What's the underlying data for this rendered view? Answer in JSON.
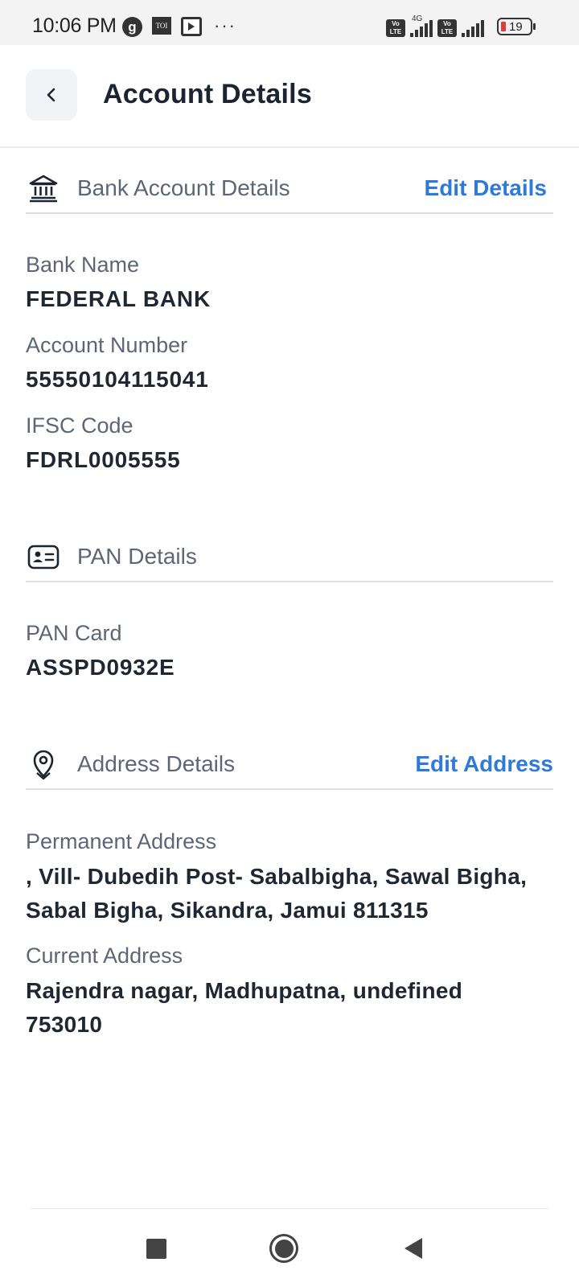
{
  "status_bar": {
    "time": "10:06 PM",
    "icons": [
      "g-app-icon",
      "toi-icon",
      "media-play-icon",
      "more-dots-icon",
      "volte-icon",
      "4g-signal-icon",
      "volte-icon",
      "signal-icon",
      "battery-icon"
    ],
    "g_label": "g",
    "toi_label": "TOI",
    "more": "···",
    "volte_label": "Vo LTE",
    "network_label": "4G",
    "battery": "19"
  },
  "header": {
    "title": "Account Details"
  },
  "bank": {
    "title": "Bank Account Details",
    "action": "Edit Details",
    "fields": [
      {
        "label": "Bank Name",
        "value": "FEDERAL BANK"
      },
      {
        "label": "Account Number",
        "value": "55550104115041"
      },
      {
        "label": "IFSC Code",
        "value": "FDRL0005555"
      }
    ]
  },
  "pan": {
    "title": "PAN Details",
    "fields": [
      {
        "label": "PAN Card",
        "value": "ASSPD0932E"
      }
    ]
  },
  "address": {
    "title": "Address Details",
    "action": "Edit Address",
    "fields": [
      {
        "label": "Permanent Address",
        "value": ", Vill- Dubedih Post- Sabalbigha, Sawal Bigha, Sabal Bigha, Sikandra, Jamui 811315"
      },
      {
        "label": "Current Address",
        "value": "Rajendra nagar, Madhupatna, undefined 753010"
      }
    ]
  },
  "colors": {
    "accent": "#2f7ad8",
    "label": "#5d6677",
    "value": "#1f2733"
  }
}
